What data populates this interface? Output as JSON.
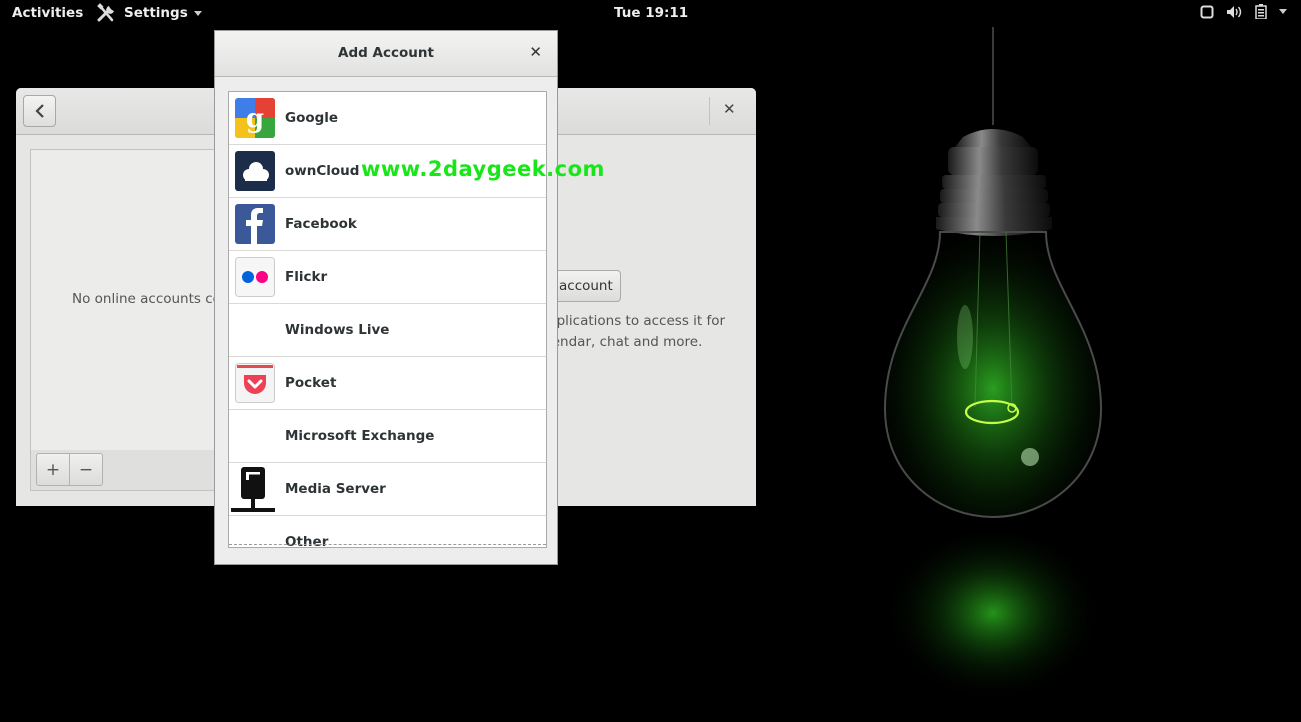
{
  "topbar": {
    "activities": "Activities",
    "app_name": "Settings",
    "clock": "Tue 19:11",
    "tray_icons": [
      "window-icon",
      "volume-icon",
      "battery-icon",
      "system-menu-caret-icon"
    ]
  },
  "settings_window": {
    "empty_text": "No online accounts co",
    "add_account_button": "account",
    "description_line1": "pplications to access it for",
    "description_line2": "lendar, chat and more.",
    "add_label": "+",
    "remove_label": "−"
  },
  "dialog": {
    "title": "Add Account",
    "providers": [
      {
        "label": "Google",
        "icon": "google-icon"
      },
      {
        "label": "ownCloud",
        "icon": "owncloud-icon"
      },
      {
        "label": "Facebook",
        "icon": "facebook-icon"
      },
      {
        "label": "Flickr",
        "icon": "flickr-icon"
      },
      {
        "label": "Windows Live",
        "icon": ""
      },
      {
        "label": "Pocket",
        "icon": "pocket-icon"
      },
      {
        "label": "Microsoft Exchange",
        "icon": ""
      },
      {
        "label": "Media Server",
        "icon": "media-server-icon"
      },
      {
        "label": "Other",
        "icon": ""
      }
    ]
  },
  "watermark": "www.2daygeek.com",
  "colors": {
    "watermark": "#19e619",
    "wallpaper_glow": "#27c21c"
  }
}
